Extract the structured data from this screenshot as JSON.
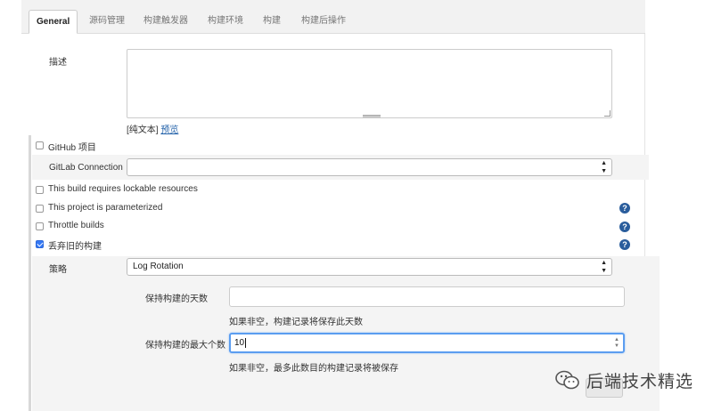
{
  "tabs": [
    {
      "label": "General",
      "active": true
    },
    {
      "label": "源码管理"
    },
    {
      "label": "构建触发器"
    },
    {
      "label": "构建环境"
    },
    {
      "label": "构建"
    },
    {
      "label": "构建后操作"
    }
  ],
  "description": {
    "label": "描述",
    "value": "",
    "format_prefix": "[纯文本]",
    "preview_link": "预览"
  },
  "github_project": {
    "label": "GitHub 项目",
    "checked": false
  },
  "gitlab": {
    "label": "GitLab Connection",
    "value": ""
  },
  "options": [
    {
      "label": "This build requires lockable resources",
      "checked": false
    },
    {
      "label": "This project is parameterized",
      "checked": false
    },
    {
      "label": "Throttle builds",
      "checked": false
    },
    {
      "label": "丢弃旧的构建",
      "checked": true
    }
  ],
  "strategy": {
    "label": "策略",
    "value": "Log Rotation",
    "days_to_keep": {
      "label": "保持构建的天数",
      "value": "",
      "hint": "如果非空，构建记录将保存此天数"
    },
    "max_builds": {
      "label": "保持构建的最大个数",
      "value": "10",
      "hint": "如果非空，最多此数目的构建记录将被保存"
    }
  },
  "watermark": {
    "text": "后端技术精选"
  },
  "icons": {
    "help": "help-icon",
    "select_arrows": "select-arrows-icon",
    "watermark": "wechat-logo-icon"
  },
  "colors": {
    "checkbox_checked": "#3478f6",
    "help_icon": "#2a5d9c",
    "link": "#1f5fa8",
    "focus_border": "#5b9df0"
  }
}
